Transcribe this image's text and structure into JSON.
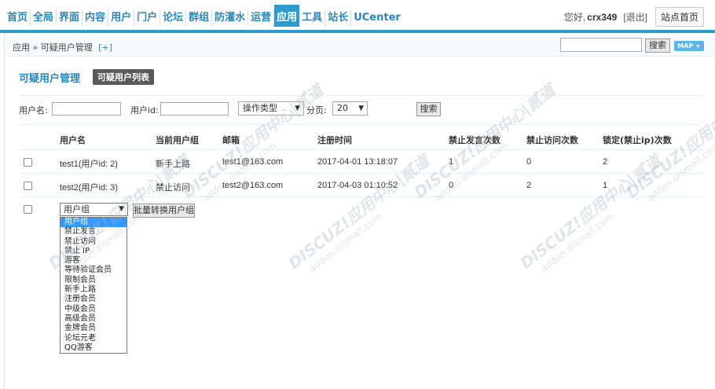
{
  "nav": {
    "items": [
      "首页",
      "全局",
      "界面",
      "内容",
      "用户",
      "门户",
      "论坛",
      "群组",
      "防灌水",
      "运营",
      "应用",
      "工具",
      "站长",
      "UCenter"
    ],
    "active": "应用"
  },
  "user": {
    "greeting": "您好,",
    "name": "crx349",
    "logout": "[退出]",
    "home": "站点首页"
  },
  "breadcrumb": {
    "text": "应用 » 可疑用户管理",
    "plus": "[+]"
  },
  "top_search": {
    "value": "",
    "button": "搜索",
    "map": "MAP +"
  },
  "page": {
    "title": "可疑用户管理",
    "tab": "可疑用户列表"
  },
  "filters": {
    "username_label": "用户名:",
    "uid_label": "用户id:",
    "op_type": "操作类型",
    "pagesize_label": "分页:",
    "pagesize_value": "20",
    "search_button": "搜索"
  },
  "table": {
    "headers": [
      "用户名",
      "当前用户组",
      "邮箱",
      "注册时间",
      "禁止发言次数",
      "禁止访问次数",
      "锁定(禁止ip)次数"
    ],
    "rows": [
      {
        "name": "test1(用户id: 2)",
        "group": "新手上路",
        "email": "test1@163.com",
        "regtime": "2017-04-01 13:18:07",
        "ban_post": "1",
        "ban_visit": "0",
        "lock_ip": "2"
      },
      {
        "name": "test2(用户id: 3)",
        "group": "禁止访问",
        "email": "test2@163.com",
        "regtime": "2017-04-03 01:10:52",
        "ban_post": "0",
        "ban_visit": "2",
        "lock_ip": "1"
      }
    ]
  },
  "batch": {
    "group_select": "用户组",
    "convert_button": "批量转换用户组",
    "options": [
      "用户组",
      "禁止发言",
      "禁止访问",
      "禁止 IP",
      "游客",
      "等待验证会员",
      "限制会员",
      "新手上路",
      "注册会员",
      "中级会员",
      "高级会员",
      "金牌会员",
      "论坛元老",
      "QQ游客"
    ]
  }
}
